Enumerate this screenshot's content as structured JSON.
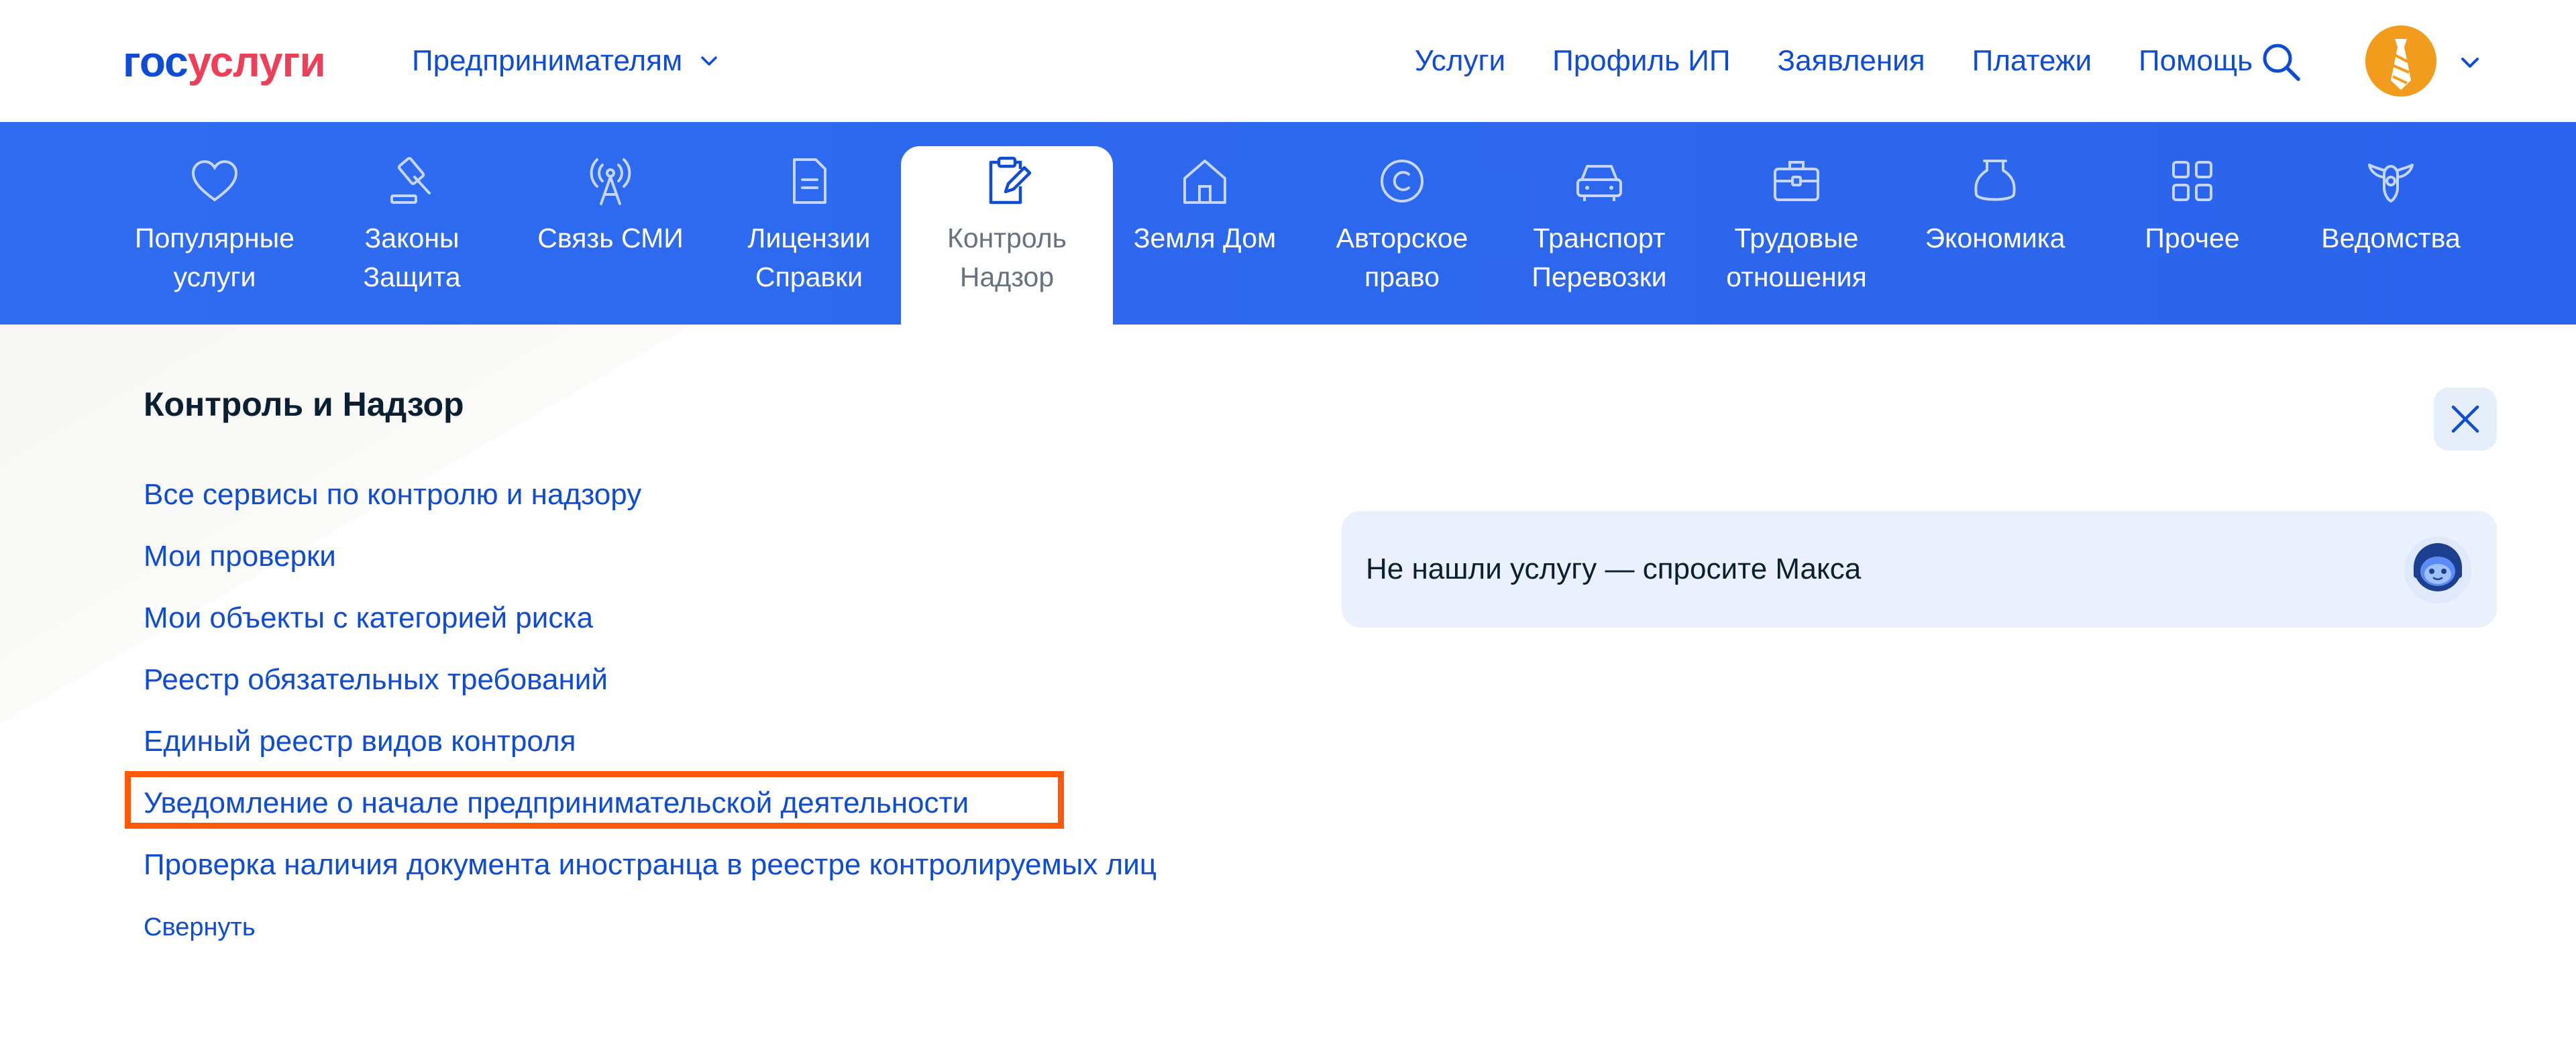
{
  "header": {
    "logo_part1": "гос",
    "logo_part2": "услуги",
    "audience": "Предпринимателям",
    "nav": [
      "Услуги",
      "Профиль ИП",
      "Заявления",
      "Платежи",
      "Помощь"
    ]
  },
  "categories": [
    {
      "label": "Популярные\nуслуги",
      "icon": "heart-icon"
    },
    {
      "label": "Законы\nЗащита",
      "icon": "gavel-icon"
    },
    {
      "label": "Связь СМИ",
      "icon": "antenna-icon"
    },
    {
      "label": "Лицензии\nСправки",
      "icon": "document-icon"
    },
    {
      "label": "Контроль\nНадзор",
      "icon": "clipboard-edit-icon",
      "active": true
    },
    {
      "label": "Земля Дом",
      "icon": "house-icon"
    },
    {
      "label": "Авторское\nправо",
      "icon": "copyright-icon"
    },
    {
      "label": "Транспорт\nПеревозки",
      "icon": "car-icon"
    },
    {
      "label": "Трудовые\nотношения",
      "icon": "briefcase-icon"
    },
    {
      "label": "Экономика",
      "icon": "wallet-icon"
    },
    {
      "label": "Прочее",
      "icon": "grid-icon"
    },
    {
      "label": "Ведомства",
      "icon": "emblem-icon"
    }
  ],
  "panel": {
    "title": "Контроль и Надзор",
    "links": [
      "Все сервисы по контролю и надзору",
      "Мои проверки",
      "Мои объекты с категорией риска",
      "Реестр обязательных требований",
      "Единый реестр видов контроля",
      "Уведомление о начале предпринимательской деятельности",
      "Проверка наличия документа иностранца в реестре контролируемых лиц"
    ],
    "collapse": "Свернуть",
    "ask": "Не нашли услугу — спросите Макса"
  },
  "colors": {
    "brand_blue": "#0d4cd3",
    "brand_red": "#ee3f58",
    "category_bar": "#2f6cf0",
    "highlight": "#ff5a0a"
  }
}
